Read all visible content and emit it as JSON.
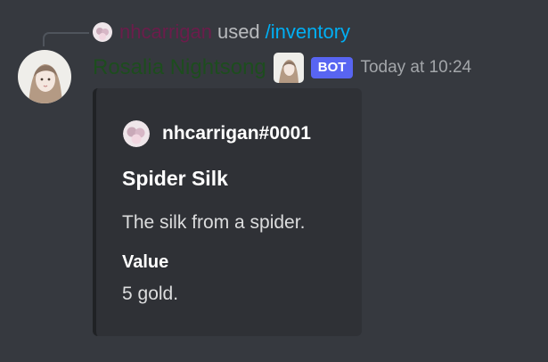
{
  "reference": {
    "user": "nhcarrigan",
    "used": "used",
    "command": "/inventory"
  },
  "message": {
    "author": "Rosalia Nightsong",
    "badge": "BOT",
    "timestamp": "Today at 10:24"
  },
  "embed": {
    "author_name": "nhcarrigan#0001",
    "title": "Spider Silk",
    "description": "The silk from a spider.",
    "fields": [
      {
        "name": "Value",
        "value": "5 gold."
      }
    ]
  },
  "colors": {
    "background": "#36393f",
    "embed_background": "#2f3136",
    "embed_border": "#202225",
    "author_name": "#1d4d1e",
    "reference_user": "#6b1d4b",
    "command_link": "#00aff4",
    "bot_badge": "#5865f2"
  },
  "icons": {
    "reference_avatar": "user-avatar-icon",
    "bot_avatar": "bot-avatar-icon",
    "embed_author_icon": "user-avatar-icon"
  }
}
